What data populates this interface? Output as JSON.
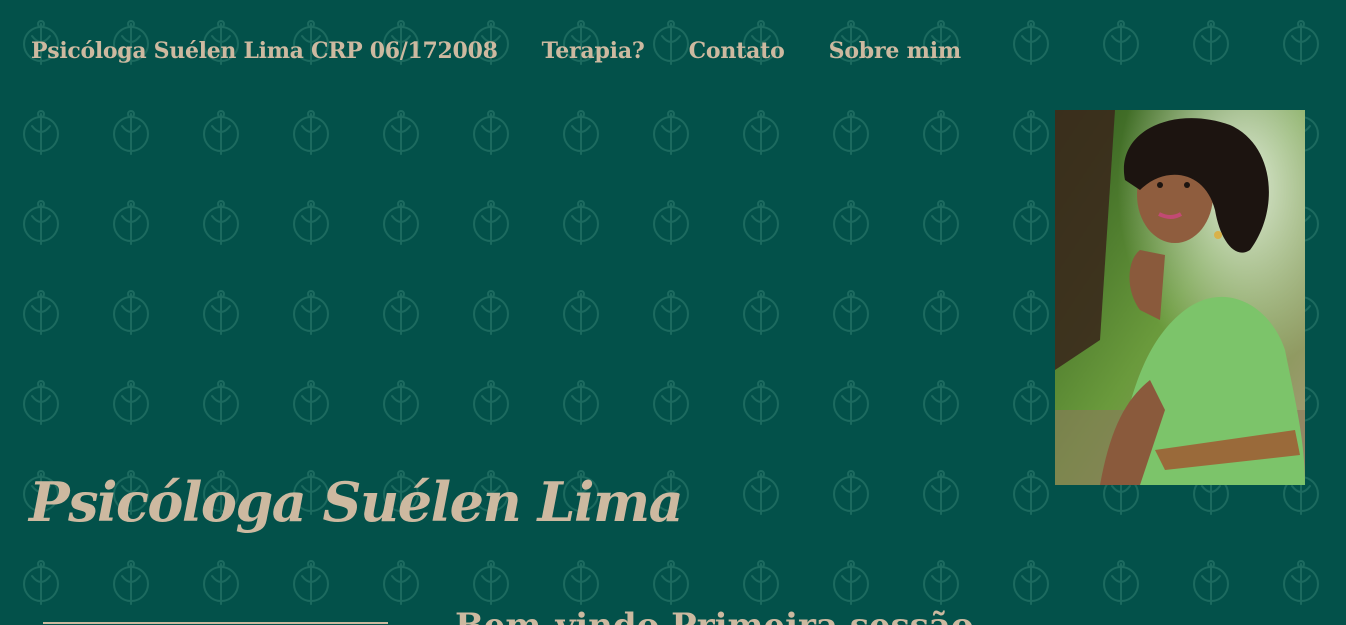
{
  "nav": {
    "brand": "Psicóloga Suélen Lima CRP 06/172008",
    "links": [
      "Terapia?",
      "Contato",
      "Sobre mim"
    ]
  },
  "hero": {
    "title": "Psicóloga Suélen Lima"
  },
  "next_section": {
    "heading": "Bem-vindo Primeira sessão"
  },
  "colors": {
    "background": "#03514a",
    "text": "#cdb9a0",
    "pattern": "#1c6a5f"
  },
  "icons": {
    "pattern": "psi-symbol-icon"
  }
}
